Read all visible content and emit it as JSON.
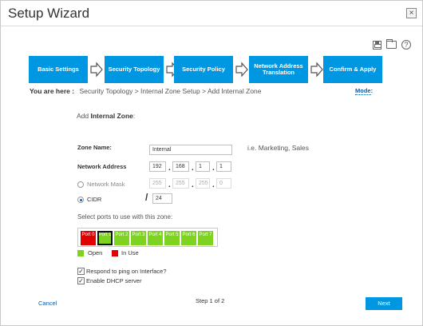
{
  "window": {
    "title": "Setup Wizard",
    "close_glyph": "×"
  },
  "toolbar_icons": [
    "save-icon",
    "folder-icon",
    "help-icon"
  ],
  "help_glyph": "?",
  "steps": [
    {
      "label": "Basic Settings",
      "active": false
    },
    {
      "label": "Security Topology",
      "active": true
    },
    {
      "label": "Security Policy",
      "active": false
    },
    {
      "label": "Network Address Translation",
      "active": false
    },
    {
      "label": "Confirm & Apply",
      "active": false
    }
  ],
  "breadcrumb": {
    "prefix": "You are here :",
    "path": "Security Topology > Internal Zone Setup > Add Internal Zone"
  },
  "mode_link": "Mode:",
  "section": {
    "prefix": "Add ",
    "bold": "Internal Zone",
    "suffix": ":"
  },
  "form": {
    "zone_name_label": "Zone Name:",
    "zone_name_value": "Internal",
    "zone_name_hint": "i.e. Marketing, Sales",
    "network_address_label": "Network Address",
    "network_address": [
      "192",
      "168",
      "1",
      "1"
    ],
    "network_mask_label": "Network Mask",
    "network_mask": [
      "255",
      "255",
      "255",
      "0"
    ],
    "cidr_label": "CIDR",
    "cidr_slash": "/",
    "cidr_value": "24",
    "mode_selected": "CIDR"
  },
  "ports_label": "Select ports to use with this zone:",
  "ports": [
    {
      "label": "Port 0",
      "state": "in_use"
    },
    {
      "label": "Port 1",
      "state": "selected"
    },
    {
      "label": "Port 2",
      "state": "open"
    },
    {
      "label": "Port 3",
      "state": "open"
    },
    {
      "label": "Port 4",
      "state": "open"
    },
    {
      "label": "Port 5",
      "state": "open"
    },
    {
      "label": "Port 6",
      "state": "open"
    },
    {
      "label": "Port 7",
      "state": "open"
    }
  ],
  "legend": {
    "open": "Open",
    "in_use": "In Use"
  },
  "colors": {
    "accent": "#0097e2",
    "open": "#7ed321",
    "in_use": "#e00000",
    "link": "#0b5da8"
  },
  "options": [
    {
      "label": "Respond to ping on Interface?",
      "checked": true
    },
    {
      "label": "Enable DHCP server",
      "checked": true
    }
  ],
  "check_glyph": "✓",
  "footer": {
    "cancel": "Cancel",
    "step_indicator": "Step 1 of 2",
    "next": "Next"
  }
}
